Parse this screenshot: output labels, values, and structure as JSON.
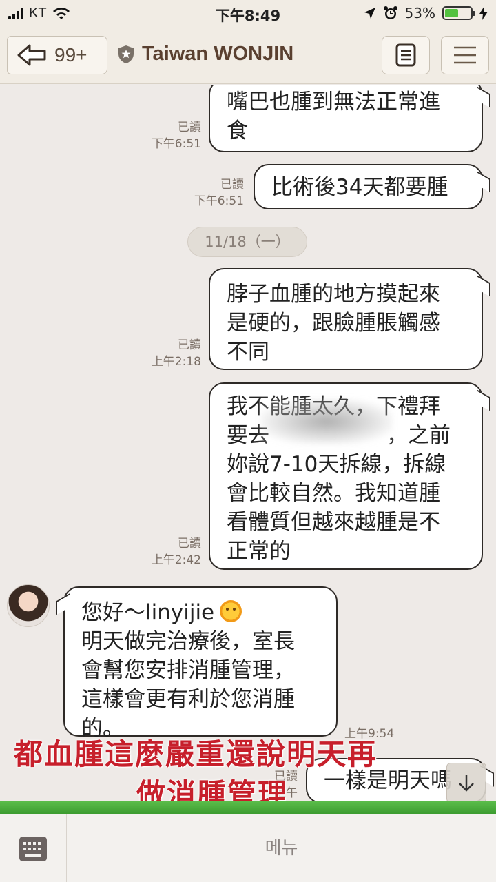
{
  "status_bar": {
    "carrier": "KT",
    "time": "下午8:49",
    "battery_percent": "53%",
    "battery_level": 0.53,
    "battery_color": "#52c140"
  },
  "header": {
    "back_count": "99+",
    "title": "Taiwan WONJIN",
    "icons": [
      "back-arrow-icon",
      "shield-star-icon",
      "note-icon",
      "menu-icon"
    ]
  },
  "chat": {
    "date_divider": "11/18（一）",
    "messages": [
      {
        "side": "me",
        "lines": [
          "嘴巴也腫到無法正常進",
          "食"
        ],
        "read": "已讀",
        "time": "下午6:51"
      },
      {
        "side": "me",
        "lines": [
          "比術後34天都要腫"
        ],
        "read": "已讀",
        "time": "下午6:51"
      },
      {
        "side": "me",
        "lines": [
          "脖子血腫的地方摸起來",
          "是硬的，跟臉腫脹觸感",
          "不同"
        ],
        "read": "已讀",
        "time": "上午2:18"
      },
      {
        "side": "me",
        "lines": [
          "我不能腫太久，下禮拜",
          "要去",
          "，之前",
          "妳說7-10天拆線，拆線",
          "會比較自然。我知道腫",
          "看體質但越來越腫是不",
          "正常的"
        ],
        "read": "已讀",
        "time": "上午2:42"
      },
      {
        "side": "them",
        "lines": [
          "您好～linyijie",
          "明天做完治療後，室長",
          "會幫您安排消腫管理，",
          "這樣會更有利於您消腫",
          "的。"
        ],
        "time": "上午9:54"
      },
      {
        "side": "me",
        "lines": [
          "一樣是明天嗎"
        ],
        "read": "已讀",
        "time": "上午"
      }
    ]
  },
  "overlay": {
    "line1": "都血腫這麼嚴重還說明天再",
    "line2": "做消腫管理",
    "color": "#c71f2b"
  },
  "bottom_bar": {
    "menu_label": "메뉴",
    "icons": [
      "keyboard-icon",
      "scroll-down-icon"
    ]
  }
}
